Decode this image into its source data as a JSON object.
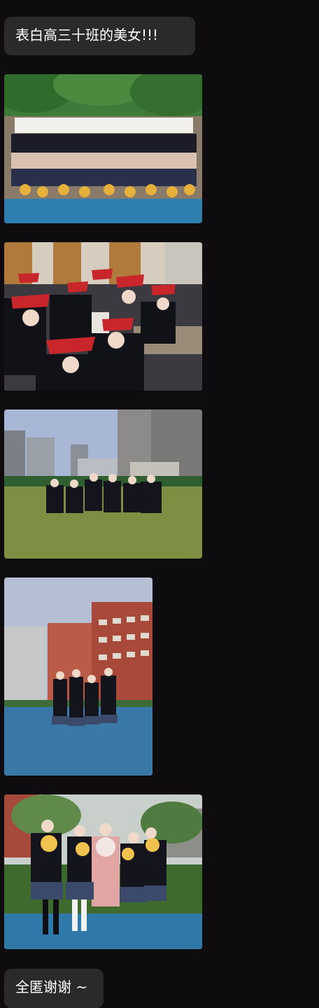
{
  "messages": [
    {
      "type": "text",
      "text": "表白高三十班的美女!!!"
    },
    {
      "type": "image",
      "description": ""
    },
    {
      "type": "image",
      "description": ""
    },
    {
      "type": "image",
      "description": ""
    },
    {
      "type": "image",
      "description": ""
    },
    {
      "type": "image",
      "description": ""
    },
    {
      "type": "text",
      "text": "全匿谢谢 ~"
    }
  ],
  "colors": {
    "background": "#0e0c0f",
    "bubble": "#2a2a2c",
    "text": "#ffffff"
  }
}
